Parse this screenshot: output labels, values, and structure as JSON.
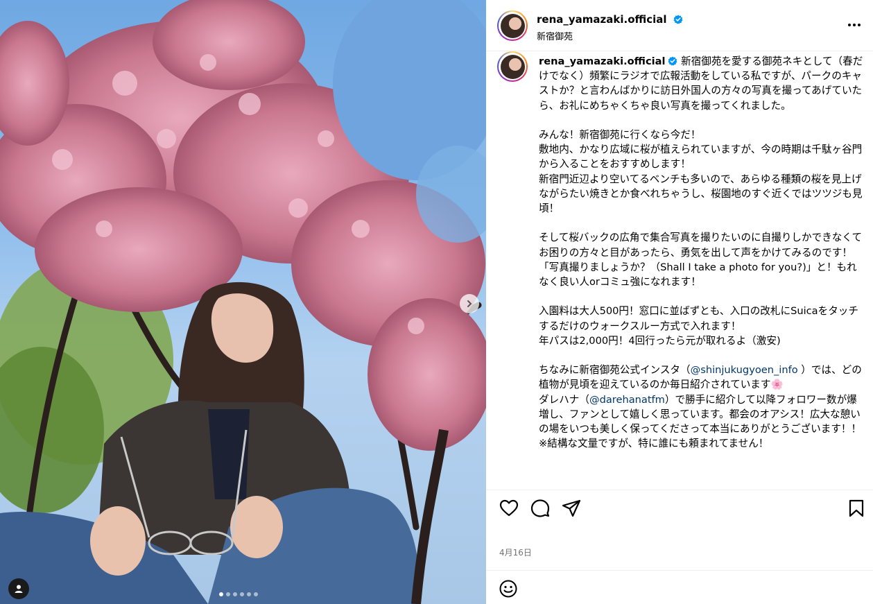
{
  "post": {
    "username": "rena_yamazaki.official",
    "location": "新宿御苑",
    "date": "4月16日",
    "verified": true
  },
  "icons": {
    "verified": "verified-badge-icon",
    "more": "more-options-icon",
    "next": "chevron-right-icon",
    "tag": "user-tag-icon",
    "like": "heart-icon",
    "comment": "comment-icon",
    "share": "paper-plane-icon",
    "save": "bookmark-icon",
    "emoji": "smiley-icon"
  },
  "colors": {
    "verified": "#0095f6",
    "mention": "#00376b",
    "meta": "#737373"
  },
  "carousel": {
    "count": 6,
    "active_index": 0
  },
  "caption": {
    "p1": " 新宿御苑を愛する御苑ネキとして（春だけでなく）頻繁にラジオで広報活動をしている私ですが、パークのキャストか？と言わんばかりに訪日外国人の方々の写真を撮ってあげていたら、お礼にめちゃくちゃ良い写真を撮ってくれました。\n\nみんな！新宿御苑に行くなら今だ！\n敷地内、かなり広域に桜が植えられていますが、今の時期は千駄ヶ谷門から入ることをおすすめします！\n新宿門近辺より空いてるベンチも多いので、あらゆる種類の桜を見上げながらたい焼きとか食べれちゃうし、桜園地のすぐ近くではツツジも見頃！\n\nそして桜バックの広角で集合写真を撮りたいのに自撮りしかできなくてお困りの方々と目があったら、勇気を出して声をかけてみるのです！\n「写真撮りましょうか？（Shall I take a photo for you?)」と！もれなく良い人orコミュ強になれます！\n\n入園料は大人500円！窓口に並ばずとも、入口の改札にSuicaをタッチするだけのウォークスルー方式で入れます！\n年パスは2,000円！4回行ったら元が取れるよ（激安)\n\nちなみに新宿御苑公式インスタ（",
    "mention1": "@shinjukugyoen_info",
    "p2": " ）では、どの植物が見頃を迎えているのか毎日紹介されています🌸\nダレハナ（",
    "mention2": "@darehanatfm",
    "p3": "）で勝手に紹介して以降フォロワー数が爆増し、ファンとして嬉しく思っています。都会のオアシス！広大な憩いの場をいつも美しく保ってくださって本当にありがとうございます！！\n※結構な文量ですが、特に誰にも頼まれてません！"
  }
}
